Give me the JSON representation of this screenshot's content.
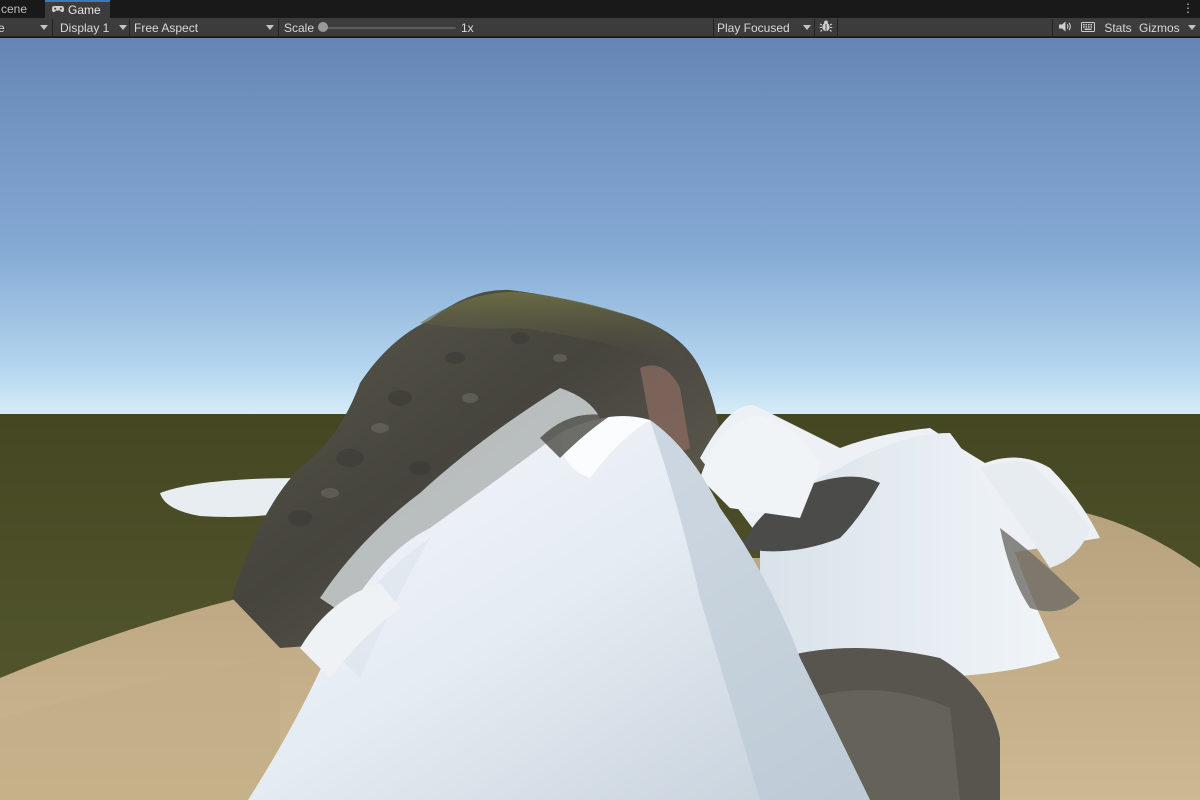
{
  "tabs": [
    {
      "label": "cene",
      "active": false,
      "icon": "scene-icon"
    },
    {
      "label": "Game",
      "active": true,
      "icon": "gamepad-icon"
    }
  ],
  "toolbar": {
    "view_dropdown": "e",
    "display": "Display 1",
    "aspect": "Free Aspect",
    "scale_label": "Scale",
    "scale_value": "1x",
    "scale_fraction": 0.0,
    "play_mode": "Play Focused",
    "stats_label": "Stats",
    "gizmos_label": "Gizmos"
  },
  "icons": [
    "gamepad-icon",
    "bug-icon",
    "speaker-icon",
    "keyboard-icon",
    "kebab-menu-icon"
  ],
  "colors": {
    "accent": "#3a79bb",
    "toolbar": "#3c3c3c",
    "sky_top": "#6586b4",
    "sky_horizon": "#d4ecf8",
    "grass": "#4d5028",
    "sand": "#c6b08a",
    "snow": "#e8eef4",
    "rock": "#4a4842"
  }
}
